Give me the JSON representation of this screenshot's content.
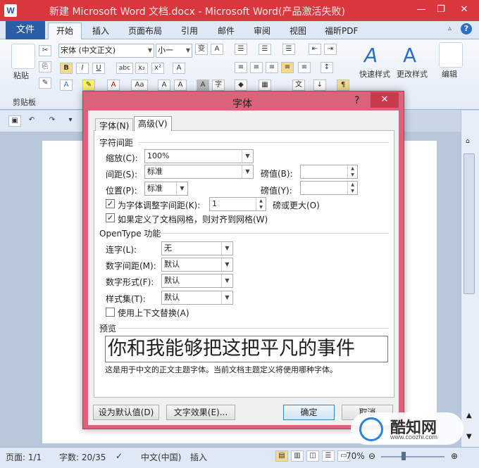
{
  "window": {
    "title": "新建 Microsoft Word 文档.docx - Microsoft Word(产品激活失败)",
    "app_icon": "W",
    "minimize": "—",
    "restore": "❐",
    "close": "✕"
  },
  "ribbon_tabs": [
    "文件",
    "开始",
    "插入",
    "页面布局",
    "引用",
    "邮件",
    "审阅",
    "视图",
    "福昕PDF"
  ],
  "ribbon": {
    "paste_label": "粘贴",
    "clipboard_group": "剪贴板",
    "font_name": "宋体 (中文正文)",
    "font_size": "小一",
    "styles_quick": "快速样式",
    "styles_change": "更改样式",
    "editing": "编辑"
  },
  "dialog": {
    "title": "字体",
    "help": "?",
    "close": "✕",
    "tabs": [
      "字体(N)",
      "高级(V)"
    ],
    "section_spacing": "字符间距",
    "scale_label": "缩放(C):",
    "scale_value": "100%",
    "spacing_label": "间距(S):",
    "spacing_value": "标准",
    "spacing_by_label": "磅值(B):",
    "position_label": "位置(P):",
    "position_value": "标准",
    "position_by_label": "磅值(Y):",
    "kerning_label": "为字体调整字间距(K):",
    "kerning_checked": true,
    "kerning_value": "1",
    "kerning_suffix": "磅或更大(O)",
    "grid_label": "如果定义了文档网格，则对齐到网格(W)",
    "grid_checked": true,
    "section_opentype": "OpenType 功能",
    "ligatures_label": "连字(L):",
    "ligatures_value": "无",
    "num_spacing_label": "数字间距(M):",
    "num_spacing_value": "默认",
    "num_forms_label": "数字形式(F):",
    "num_forms_value": "默认",
    "stylistic_label": "样式集(T):",
    "stylistic_value": "默认",
    "contextual_label": "使用上下文替换(A)",
    "contextual_checked": false,
    "section_preview": "预览",
    "preview_text": "你和我能够把这把平凡的事件",
    "preview_note": "这是用于中文的正文主题字体。当前文档主题定义将使用哪种字体。",
    "btn_default": "设为默认值(D)",
    "btn_effects": "文字效果(E)...",
    "btn_ok": "确定",
    "btn_cancel": "取消"
  },
  "status": {
    "page": "页面: 1/1",
    "words": "字数: 20/35",
    "language": "中文(中国)",
    "insert": "插入",
    "zoom": "70%"
  },
  "watermark": {
    "name": "酷知网",
    "url": "www.coozhi.com"
  }
}
